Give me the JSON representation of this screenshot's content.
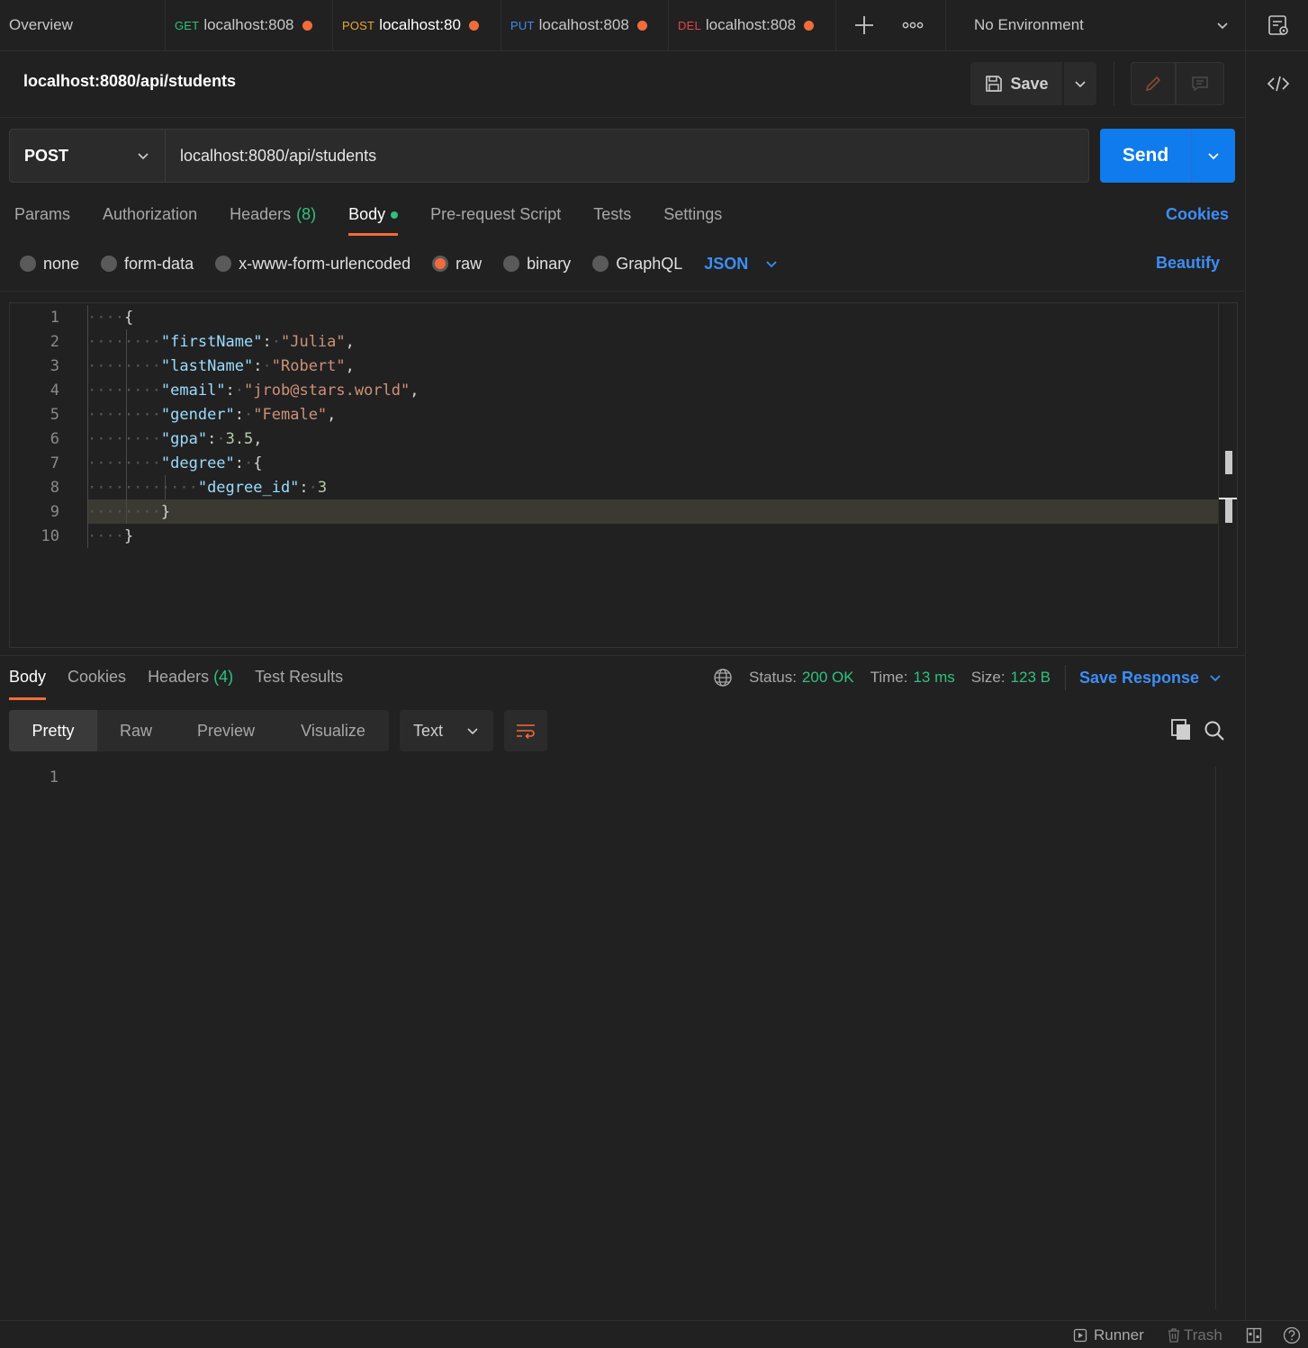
{
  "tabs": [
    {
      "label": "Overview",
      "method": "",
      "dirty": false
    },
    {
      "label": "localhost:808",
      "method": "GET",
      "dirty": true
    },
    {
      "label": "localhost:80",
      "method": "POST",
      "dirty": true,
      "active": true
    },
    {
      "label": "localhost:808",
      "method": "PUT",
      "dirty": true
    },
    {
      "label": "localhost:808",
      "method": "DEL",
      "dirty": true
    }
  ],
  "environment": {
    "label": "No Environment"
  },
  "request": {
    "title": "localhost:8080/api/students",
    "save_label": "Save",
    "method": "POST",
    "url": "localhost:8080/api/students",
    "send_label": "Send"
  },
  "request_tabs": [
    {
      "label": "Params"
    },
    {
      "label": "Authorization"
    },
    {
      "label": "Headers",
      "count": "(8)"
    },
    {
      "label": "Body",
      "active": true
    },
    {
      "label": "Pre-request Script"
    },
    {
      "label": "Tests"
    },
    {
      "label": "Settings"
    }
  ],
  "cookies_link": "Cookies",
  "body_options": [
    {
      "label": "none",
      "selected": false
    },
    {
      "label": "form-data",
      "selected": false
    },
    {
      "label": "x-www-form-urlencoded",
      "selected": false
    },
    {
      "label": "raw",
      "selected": true
    },
    {
      "label": "binary",
      "selected": false
    },
    {
      "label": "GraphQL",
      "selected": false
    }
  ],
  "body_format": "JSON",
  "beautify_label": "Beautify",
  "editor": {
    "line_numbers": [
      "1",
      "2",
      "3",
      "4",
      "5",
      "6",
      "7",
      "8",
      "9",
      "10"
    ],
    "lines": [
      {
        "ws": "····",
        "parts": [
          [
            "p",
            "{"
          ]
        ]
      },
      {
        "ws": "········",
        "parts": [
          [
            "k",
            "\"firstName\""
          ],
          [
            "p",
            ":"
          ],
          [
            "ws",
            "·"
          ],
          [
            "s",
            "\"Julia\""
          ],
          [
            "p",
            ","
          ]
        ]
      },
      {
        "ws": "········",
        "parts": [
          [
            "k",
            "\"lastName\""
          ],
          [
            "p",
            ":"
          ],
          [
            "ws",
            "·"
          ],
          [
            "s",
            "\"Robert\""
          ],
          [
            "p",
            ","
          ]
        ]
      },
      {
        "ws": "········",
        "parts": [
          [
            "k",
            "\"email\""
          ],
          [
            "p",
            ":"
          ],
          [
            "ws",
            "·"
          ],
          [
            "s",
            "\"jrob@stars.world\""
          ],
          [
            "p",
            ","
          ]
        ]
      },
      {
        "ws": "········",
        "parts": [
          [
            "k",
            "\"gender\""
          ],
          [
            "p",
            ":"
          ],
          [
            "ws",
            "·"
          ],
          [
            "s",
            "\"Female\""
          ],
          [
            "p",
            ","
          ]
        ]
      },
      {
        "ws": "········",
        "parts": [
          [
            "k",
            "\"gpa\""
          ],
          [
            "p",
            ":"
          ],
          [
            "ws",
            "·"
          ],
          [
            "n",
            "3.5"
          ],
          [
            "p",
            ","
          ]
        ]
      },
      {
        "ws": "········",
        "parts": [
          [
            "k",
            "\"degree\""
          ],
          [
            "p",
            ":"
          ],
          [
            "ws",
            "·"
          ],
          [
            "p",
            "{"
          ]
        ]
      },
      {
        "ws": "············",
        "parts": [
          [
            "k",
            "\"degree_id\""
          ],
          [
            "p",
            ":"
          ],
          [
            "ws",
            "·"
          ],
          [
            "n",
            "3"
          ]
        ]
      },
      {
        "ws": "········",
        "parts": [
          [
            "p",
            "}"
          ]
        ]
      },
      {
        "ws": "····",
        "parts": [
          [
            "p",
            "}"
          ]
        ]
      }
    ]
  },
  "response": {
    "tabs": [
      {
        "label": "Body",
        "active": true
      },
      {
        "label": "Cookies"
      },
      {
        "label": "Headers",
        "count": "(4)"
      },
      {
        "label": "Test Results"
      }
    ],
    "status_label": "Status:",
    "status_value": "200 OK",
    "time_label": "Time:",
    "time_value": "13 ms",
    "size_label": "Size:",
    "size_value": "123 B",
    "save_response_label": "Save Response",
    "views": [
      {
        "label": "Pretty",
        "active": true
      },
      {
        "label": "Raw"
      },
      {
        "label": "Preview"
      },
      {
        "label": "Visualize"
      }
    ],
    "format": "Text",
    "line_numbers": [
      "1"
    ]
  },
  "statusbar": {
    "runner_label": "Runner",
    "trash_label": "Trash"
  },
  "colors": {
    "accent_orange": "#f26b3a",
    "send_blue": "#0f7bec",
    "link_blue": "#3c8ef5",
    "success_green": "#2ec27e"
  }
}
